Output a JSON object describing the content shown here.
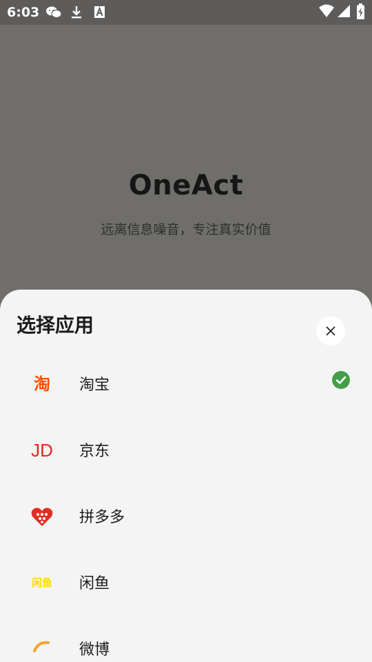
{
  "status_bar": {
    "time": "6:03",
    "icons": [
      "wechat-icon",
      "download-icon",
      "font-a-icon",
      "wifi-icon",
      "signal-icon",
      "battery-charging-icon"
    ]
  },
  "background": {
    "app_name": "OneAct",
    "tagline": "远离信息噪音，专注真实价值"
  },
  "sheet": {
    "title": "选择应用",
    "close_icon": "close-icon",
    "apps": [
      {
        "label": "淘宝",
        "logo_text": "淘",
        "selected": true,
        "color": "#ff5000"
      },
      {
        "label": "京东",
        "logo_text": "JD",
        "selected": false,
        "color": "#e1251b"
      },
      {
        "label": "拼多多",
        "logo_text": "",
        "selected": false,
        "color": "#e02e24"
      },
      {
        "label": "闲鱼",
        "logo_text": "闲鱼",
        "selected": false,
        "color": "#ffda00"
      },
      {
        "label": "微博",
        "logo_text": "",
        "selected": false,
        "color": "#f5a623"
      }
    ]
  },
  "colors": {
    "check_green": "#43a047",
    "sheet_bg": "#f4f4f4",
    "scrim": "#6f6e6b"
  }
}
